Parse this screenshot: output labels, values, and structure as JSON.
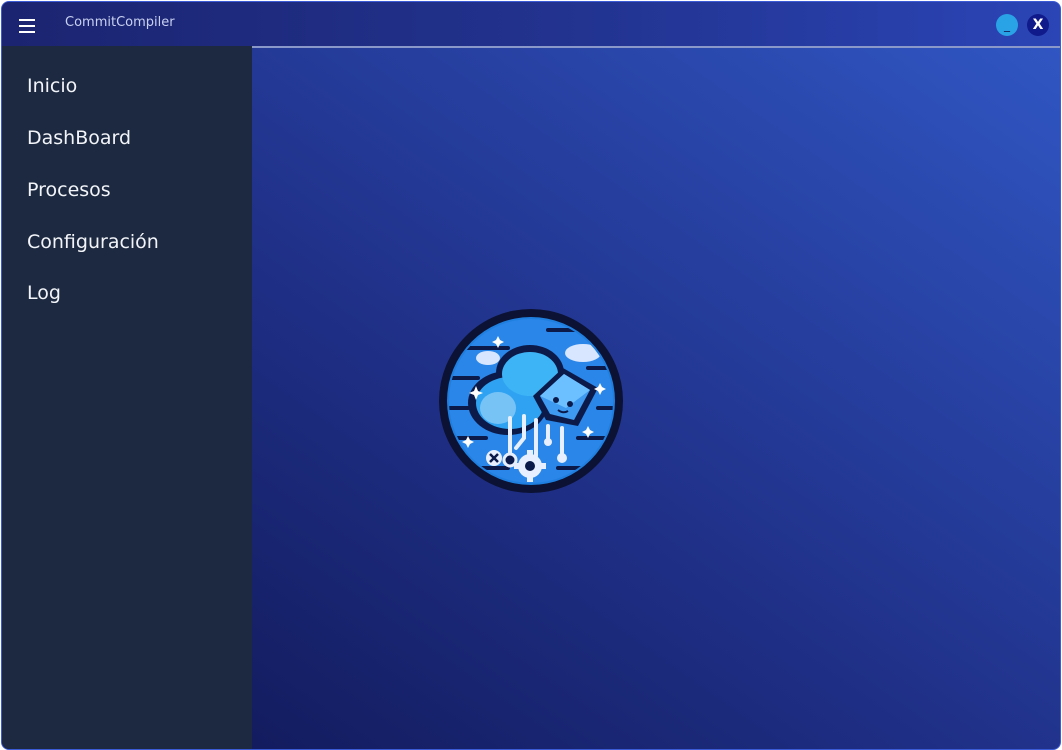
{
  "window": {
    "title": "CommitCompiler",
    "minimize_label": "_",
    "close_label": "X"
  },
  "icons": {
    "menu": "hamburger-menu-icon",
    "logo": "cloud-circuit-logo"
  },
  "sidebar": {
    "items": [
      {
        "label": "Inicio"
      },
      {
        "label": "DashBoard"
      },
      {
        "label": "Procesos"
      },
      {
        "label": "Configuración"
      },
      {
        "label": "Log"
      }
    ]
  },
  "colors": {
    "sidebar_bg": "#1c2940",
    "content_gradient_start": "#0e1550",
    "content_gradient_end": "#3158c6",
    "minimize_button": "#29a3e6",
    "close_button": "#101a8a"
  }
}
